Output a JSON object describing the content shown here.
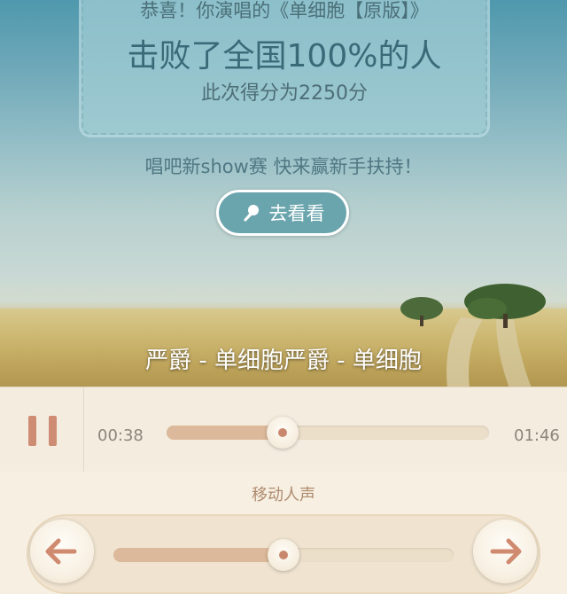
{
  "result": {
    "congrats_text": "恭喜！你演唱的《单细胞【原版】》",
    "beat_text": "击败了全国100%的人",
    "score_text": "此次得分为2250分"
  },
  "promo": {
    "text": "唱吧新show赛 快来赢新手扶持！",
    "button_label": "去看看",
    "button_icon": "microphone-icon"
  },
  "song_title": "严爵 - 单细胞严爵 - 单细胞",
  "player": {
    "state": "playing",
    "pause_icon": "pause-icon",
    "elapsed": "00:38",
    "duration": "01:46",
    "progress": 0.36
  },
  "vocal": {
    "title": "移动人声",
    "left_icon": "arrow-left-icon",
    "right_icon": "arrow-right-icon",
    "position": 0.5
  },
  "colors": {
    "accent": "#6aa5ad",
    "progress_fill": "#dcb99a",
    "pause": "#cf8c74",
    "arrow": "#d08a70"
  }
}
